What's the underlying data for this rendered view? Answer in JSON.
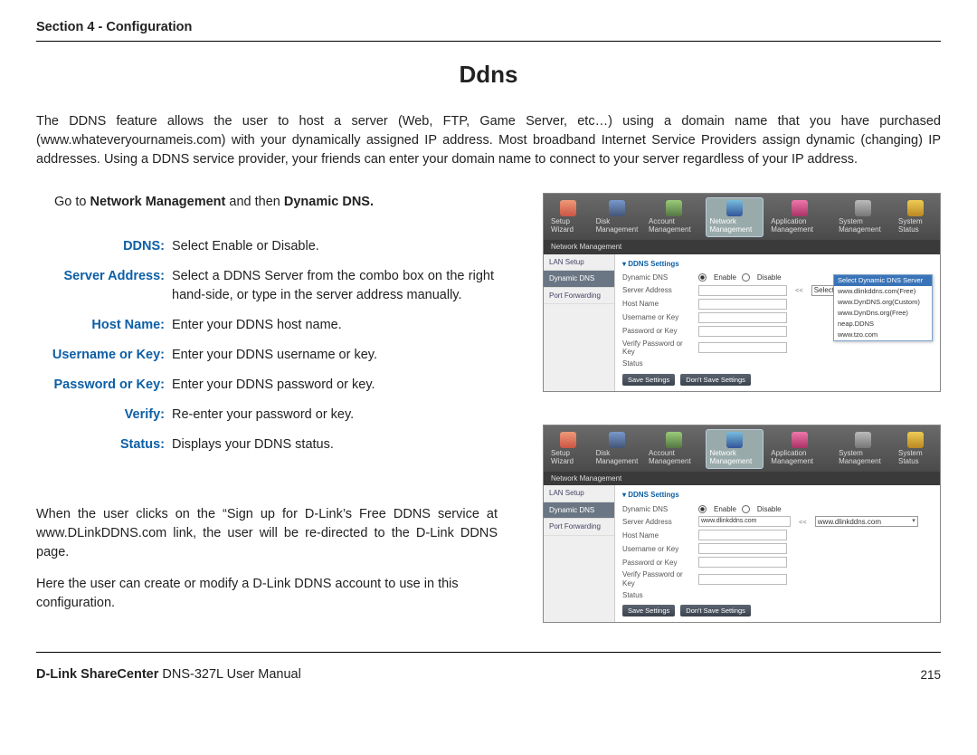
{
  "header": {
    "section": "Section 4 - Configuration"
  },
  "title": "Ddns",
  "intro": "The DDNS feature allows the user to host a server (Web, FTP, Game Server, etc…) using a domain name that you have purchased (www.whateveryournameis.com) with your dynamically assigned IP address. Most broadband Internet Service Providers assign dynamic (changing) IP addresses. Using a DDNS service provider, your friends can enter your domain name to connect to your server regardless of your IP address.",
  "go_pre": "Go to ",
  "go_b1": "Network Management",
  "go_mid": " and then ",
  "go_b2": "Dynamic DNS.",
  "defs": [
    {
      "label": "DDNS:",
      "desc": "Select Enable or Disable."
    },
    {
      "label": "Server Address:",
      "desc": "Select a DDNS Server from the combo box on the right hand-side, or type in the server address manually."
    },
    {
      "label": "Host Name:",
      "desc": "Enter your DDNS host name."
    },
    {
      "label": "Username or Key:",
      "desc": "Enter your DDNS username or key."
    },
    {
      "label": "Password or Key:",
      "desc": "Enter your DDNS password or key."
    },
    {
      "label": "Verify:",
      "desc": "Re-enter your password or key."
    },
    {
      "label": "Status:",
      "desc": "Displays your DDNS status."
    }
  ],
  "note1": "When the user clicks on the “Sign up for D-Link’s Free DDNS service at www.DLinkDDNS.com link, the user will be re-directed to the D-Link DDNS page.",
  "note2": "Here the user can create or modify a D-Link DDNS account to use in this configuration.",
  "footer": {
    "brand_bold": "D-Link ShareCenter",
    "brand_rest": " DNS-327L User Manual",
    "page": "215"
  },
  "shot": {
    "nav": [
      "Setup Wizard",
      "Disk Management",
      "Account Management",
      "Network Management",
      "Application Management",
      "System Management",
      "System Status"
    ],
    "crumb": "Network Management",
    "side": [
      "LAN Setup",
      "Dynamic DNS",
      "Port Forwarding"
    ],
    "panel_title": "DDNS Settings",
    "rows": [
      "Dynamic DNS",
      "Server Address",
      "Host Name",
      "Username or Key",
      "Password or Key",
      "Verify Password or Key",
      "Status"
    ],
    "enable": "Enable",
    "disable": "Disable",
    "ll": "<<",
    "sel_placeholder": "Select Dynamic DNS Server",
    "sel_value2": "www.dlinkddns.com",
    "input_value2": "www.dlinkddns.com",
    "options": [
      "Select Dynamic DNS Server",
      "www.dlinkddns.com(Free)",
      "www.DynDNS.org(Custom)",
      "www.DynDns.org(Free)",
      "neap.DDNS",
      "www.tzo.com"
    ],
    "btn_save": "Save Settings",
    "btn_dont": "Don't Save Settings"
  }
}
